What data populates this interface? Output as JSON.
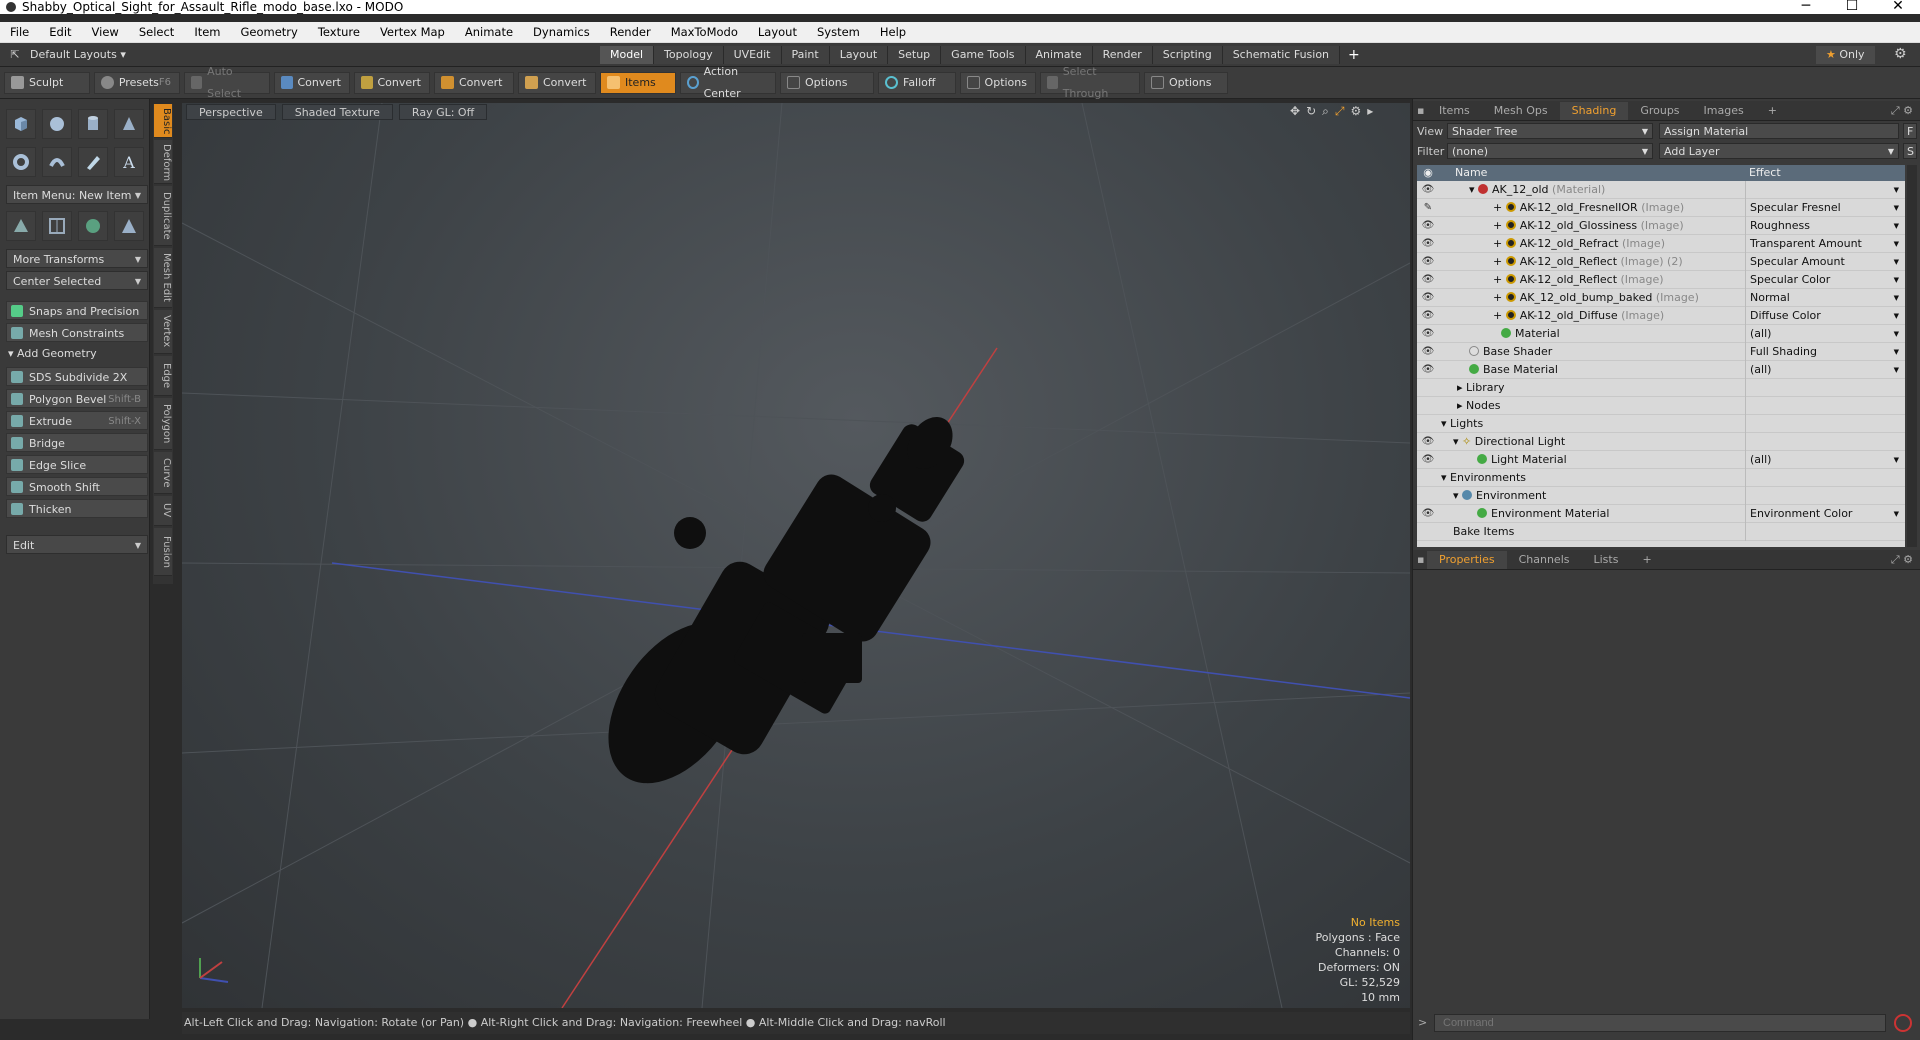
{
  "title": "Shabby_Optical_Sight_for_Assault_Rifle_modo_base.lxo - MODO",
  "window_controls": {
    "minimize": "─",
    "maximize": "☐",
    "close": "✕"
  },
  "menu": [
    "File",
    "Edit",
    "View",
    "Select",
    "Item",
    "Geometry",
    "Texture",
    "Vertex Map",
    "Animate",
    "Dynamics",
    "Render",
    "MaxToModo",
    "Layout",
    "System",
    "Help"
  ],
  "layout_bar": {
    "layouts": "Default Layouts",
    "tabs": [
      "Model",
      "Topology",
      "UVEdit",
      "Paint",
      "Layout",
      "Setup",
      "Game Tools",
      "Animate",
      "Render",
      "Scripting",
      "Schematic Fusion"
    ],
    "add": "+",
    "only": "Only"
  },
  "toolbar": {
    "sculpt": "Sculpt",
    "presets": "Presets",
    "presets_key": "F6",
    "auto_select": "Auto Select",
    "convert": "Convert",
    "items": "Items",
    "action_center": "Action Center",
    "options": "Options",
    "falloff": "Falloff",
    "select_through": "Select Through"
  },
  "left_panel": {
    "item_menu": "Item Menu: New Item",
    "more_transforms": "More Transforms",
    "center_selected": "Center Selected",
    "snaps": "Snaps and Precision",
    "mesh_constraints": "Mesh Constraints",
    "add_geometry": "Add Geometry",
    "tools": [
      {
        "label": "SDS Subdivide 2X",
        "key": ""
      },
      {
        "label": "Polygon Bevel",
        "key": "Shift-B"
      },
      {
        "label": "Extrude",
        "key": "Shift-X"
      },
      {
        "label": "Bridge",
        "key": ""
      },
      {
        "label": "Edge Slice",
        "key": ""
      },
      {
        "label": "Smooth Shift",
        "key": ""
      },
      {
        "label": "Thicken",
        "key": ""
      }
    ],
    "edit": "Edit",
    "vtabs": [
      "Basic",
      "Deform",
      "Duplicate",
      "Mesh Edit",
      "Vertex",
      "Edge",
      "Polygon",
      "Curve",
      "UV",
      "Fusion"
    ]
  },
  "viewport": {
    "perspective": "Perspective",
    "shaded": "Shaded Texture",
    "raygl": "Ray GL: Off",
    "hud": {
      "no_items": "No Items",
      "polygons": "Polygons : Face",
      "channels": "Channels: 0",
      "deformers": "Deformers: ON",
      "gl": "GL: 52,529",
      "scale": "10 mm"
    }
  },
  "status": "Alt-Left Click and Drag: Navigation: Rotate (or Pan) ● Alt-Right Click and Drag: Navigation: Freewheel ● Alt-Middle Click and Drag: navRoll",
  "right_panel": {
    "tabs": [
      "Items",
      "Mesh Ops",
      "Shading",
      "Groups",
      "Images"
    ],
    "view_label": "View",
    "view_value": "Shader Tree",
    "assign_material": "Assign Material",
    "filter_label": "Filter",
    "filter_value": "(none)",
    "add_layer": "Add Layer",
    "col_name": "Name",
    "col_effect": "Effect",
    "rows": [
      {
        "name": "AK_12_old",
        "tag": "(Material)",
        "effect": ""
      },
      {
        "name": "AK-12_old_FresnelIOR",
        "tag": "(Image)",
        "effect": "Specular Fresnel"
      },
      {
        "name": "AK-12_old_Glossiness",
        "tag": "(Image)",
        "effect": "Roughness"
      },
      {
        "name": "AK-12_old_Refract",
        "tag": "(Image)",
        "effect": "Transparent Amount"
      },
      {
        "name": "AK-12_old_Reflect",
        "tag": "(Image) (2)",
        "effect": "Specular Amount"
      },
      {
        "name": "AK-12_old_Reflect",
        "tag": "(Image)",
        "effect": "Specular Color"
      },
      {
        "name": "AK_12_old_bump_baked",
        "tag": "(Image)",
        "effect": "Normal"
      },
      {
        "name": "AK-12_old_Diffuse",
        "tag": "(Image)",
        "effect": "Diffuse Color"
      },
      {
        "name": "Material",
        "tag": "",
        "effect": "(all)"
      },
      {
        "name": "Base Shader",
        "tag": "",
        "effect": "Full Shading"
      },
      {
        "name": "Base Material",
        "tag": "",
        "effect": "(all)"
      },
      {
        "name": "Library",
        "tag": "",
        "effect": ""
      },
      {
        "name": "Nodes",
        "tag": "",
        "effect": ""
      },
      {
        "name": "Lights",
        "tag": "",
        "effect": ""
      },
      {
        "name": "Directional Light",
        "tag": "",
        "effect": ""
      },
      {
        "name": "Light Material",
        "tag": "",
        "effect": "(all)"
      },
      {
        "name": "Environments",
        "tag": "",
        "effect": ""
      },
      {
        "name": "Environment",
        "tag": "",
        "effect": ""
      },
      {
        "name": "Environment Material",
        "tag": "",
        "effect": "Environment Color"
      },
      {
        "name": "Bake Items",
        "tag": "",
        "effect": ""
      }
    ],
    "prop_tabs": [
      "Properties",
      "Channels",
      "Lists"
    ],
    "command_placeholder": "Command"
  },
  "colors": {
    "accent": "#e08a1e",
    "tree_bg": "#d9d9d9",
    "axis_x": "#c04040",
    "axis_z": "#4050b0"
  }
}
